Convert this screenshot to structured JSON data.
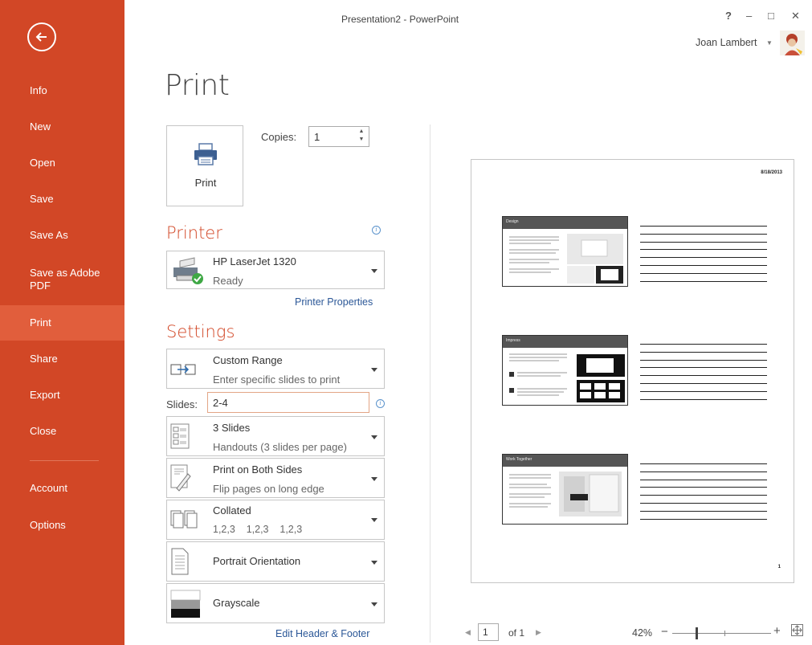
{
  "window": {
    "title": "Presentation2 - PowerPoint",
    "help": "?",
    "minimize": "–",
    "maximize": "□",
    "close": "✕"
  },
  "user": {
    "name": "Joan Lambert"
  },
  "nav": {
    "items": [
      "Info",
      "New",
      "Open",
      "Save",
      "Save As",
      "Save as Adobe PDF",
      "Print",
      "Share",
      "Export",
      "Close",
      "Account",
      "Options"
    ],
    "selected": "Print"
  },
  "page": {
    "heading": "Print"
  },
  "print": {
    "button_label": "Print",
    "copies_label": "Copies:",
    "copies_value": "1"
  },
  "printer": {
    "section_title": "Printer",
    "name": "HP LaserJet 1320",
    "status": "Ready",
    "properties_link": "Printer Properties"
  },
  "settings": {
    "section_title": "Settings",
    "range": {
      "title": "Custom Range",
      "subtitle": "Enter specific slides to print"
    },
    "slides_label": "Slides:",
    "slides_value": "2-4",
    "layout": {
      "title": "3 Slides",
      "subtitle": "Handouts (3 slides per page)"
    },
    "sides": {
      "title": "Print on Both Sides",
      "subtitle": "Flip pages on long edge"
    },
    "collation": {
      "title": "Collated",
      "subtitle": "1,2,3    1,2,3    1,2,3"
    },
    "orientation": {
      "title": "Portrait Orientation"
    },
    "color": {
      "title": "Grayscale"
    },
    "header_footer_link": "Edit Header & Footer"
  },
  "preview": {
    "date": "8/18/2013",
    "page_number": "1",
    "slides": [
      {
        "title": "Design"
      },
      {
        "title": "Impress"
      },
      {
        "title": "Work Together"
      }
    ]
  },
  "pager": {
    "current": "1",
    "of_label": "of 1"
  },
  "zoom": {
    "value": "42%",
    "level_percent": 42
  }
}
